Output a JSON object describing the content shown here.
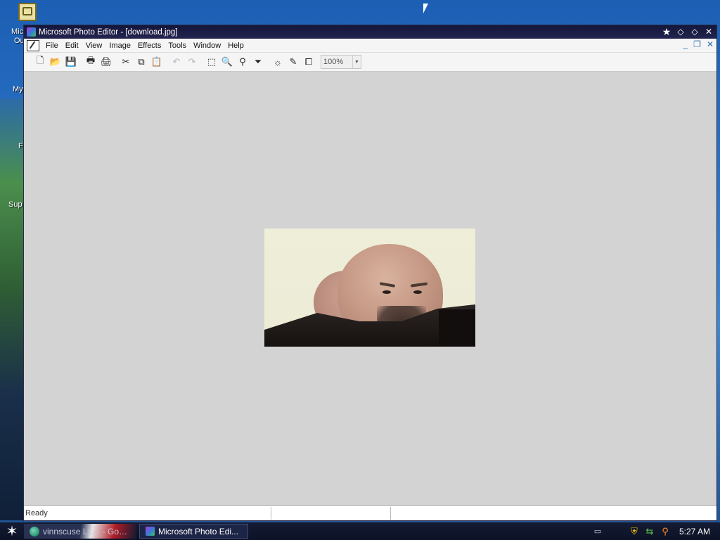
{
  "desktop": {
    "icon_labels": [
      "Mic",
      "Ou",
      "My",
      "F",
      "Sup"
    ]
  },
  "window": {
    "title": "Microsoft Photo Editor - [download.jpg]"
  },
  "menu": {
    "items": [
      "File",
      "Edit",
      "View",
      "Image",
      "Effects",
      "Tools",
      "Window",
      "Help"
    ]
  },
  "toolbar": {
    "buttons": [
      {
        "name": "new-icon",
        "glyph": "🗋",
        "enabled": true
      },
      {
        "name": "open-icon",
        "glyph": "📂",
        "enabled": true
      },
      {
        "name": "save-icon",
        "glyph": "💾",
        "enabled": false
      },
      {
        "name": "print-icon",
        "glyph": "🖶",
        "enabled": true
      },
      {
        "name": "scan-icon",
        "glyph": "🖨",
        "enabled": true
      },
      {
        "name": "cut-icon",
        "glyph": "✂",
        "enabled": true
      },
      {
        "name": "copy-icon",
        "glyph": "⧉",
        "enabled": true
      },
      {
        "name": "paste-icon",
        "glyph": "📋",
        "enabled": false
      },
      {
        "name": "undo-icon",
        "glyph": "↶",
        "enabled": false
      },
      {
        "name": "redo-icon",
        "glyph": "↷",
        "enabled": false
      },
      {
        "name": "select-icon",
        "glyph": "⬚",
        "enabled": true
      },
      {
        "name": "zoom-icon",
        "glyph": "🔍",
        "enabled": true
      },
      {
        "name": "stamp-icon",
        "glyph": "⚲",
        "enabled": true
      },
      {
        "name": "funnel-icon",
        "glyph": "⏷",
        "enabled": true
      },
      {
        "name": "brightness-icon",
        "glyph": "☼",
        "enabled": true
      },
      {
        "name": "pen-icon",
        "glyph": "✎",
        "enabled": true
      },
      {
        "name": "crop-icon",
        "glyph": "⧠",
        "enabled": true
      }
    ],
    "zoom_value": "100%"
  },
  "statusbar": {
    "status_text": "Ready"
  },
  "taskbar": {
    "tasks": [
      {
        "label": "vinnscuse Lx… - Go…",
        "active": false
      },
      {
        "label": "Microsoft Photo Edi...",
        "active": true
      }
    ],
    "clock": "5:27 AM"
  }
}
